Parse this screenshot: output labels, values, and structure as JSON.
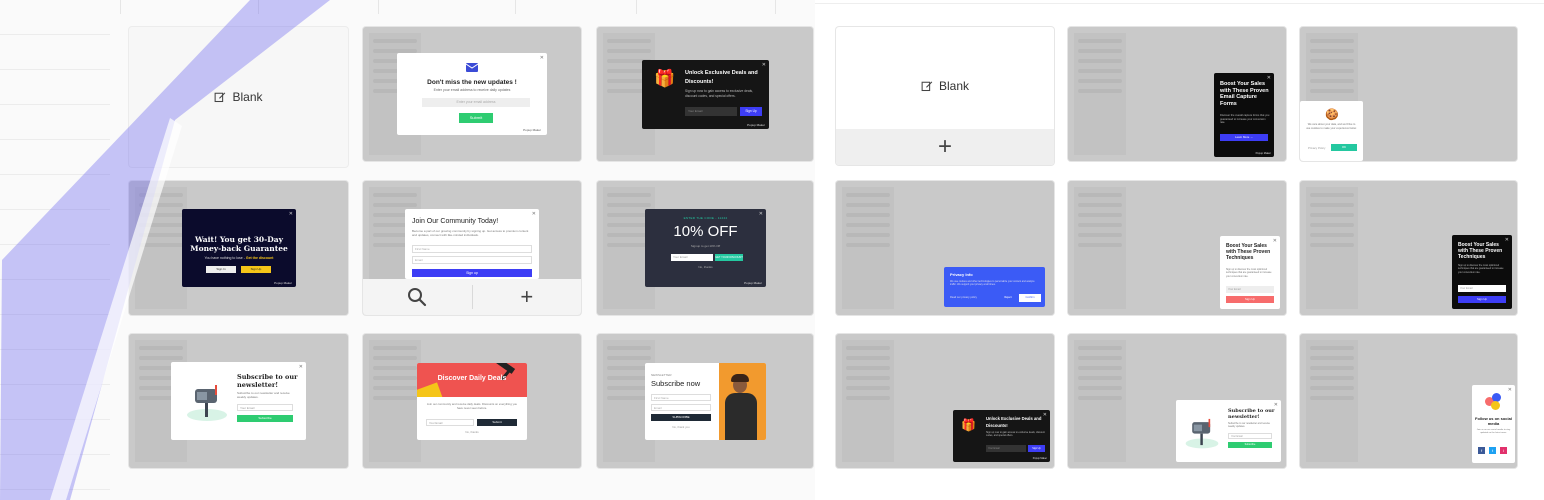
{
  "blank_label": "Blank",
  "add_symbol": "+",
  "search_symbol": "⚲",
  "templates": {
    "newsletter_envelope": {
      "title": "Don't miss the new updates !",
      "subtitle": "Enter your email address to receive daily updates",
      "placeholder": "Enter your email address",
      "button": "Submit",
      "brand": "Popup Maker"
    },
    "gift_deals": {
      "title": "Unlock Exclusive Deals and Discounts!",
      "body": "Sign up now to gain access to exclusive deals, discount codes, and special offers.",
      "placeholder": "Your Email",
      "button": "Sign Up",
      "brand": "Popup Maker"
    },
    "money_back": {
      "title": "Wait! You get 30-Day Money-back Guarantee",
      "body_a": "You have nothing to lose - ",
      "body_b": "Get the discount",
      "btn_a": "Sign In",
      "btn_b": "Sign Up",
      "brand": "Popup Maker"
    },
    "community": {
      "title": "Join Our Community Today!",
      "body": "Become a part of our growing community by signing up. Get access to premium content and updates, connect with like-minded individuals.",
      "field_a": "First Name",
      "field_b": "Email",
      "button": "Sign up"
    },
    "ten_off": {
      "kicker": "ENTER THE CODE - 11222",
      "title": "10% OFF",
      "sub": "Signup to get 10% Off",
      "placeholder": "Your Email",
      "button": "GET YOUR DISCOUNT",
      "note": "No, thanks",
      "brand": "Popup Maker"
    },
    "subscribe_mailbox": {
      "title": "Subscribe to our newsletter!",
      "body": "Subscribe to our newsletter and receive weekly updates.",
      "placeholder": "Your Email",
      "button": "Subscribe"
    },
    "daily_deals": {
      "title": "Discover Daily Deals",
      "body": "Join our community and receive daily deals. Discounts on everything you have never seen before.",
      "placeholder": "Your Email",
      "button": "Submit",
      "note": "No, thanks"
    },
    "subscribe_now": {
      "kicker": "NEWSLETTER",
      "title": "Subscribe now",
      "field_a": "First Name",
      "field_b": "Email",
      "button": "SUBSCRIBE",
      "note": "No, thank you"
    },
    "boost_dark": {
      "title": "Boost Your Sales with These Proven Email Capture Forms",
      "body": "Discover the overall capture forms that you guaranteed to increase your conversion rate.",
      "button": "Learn More  →",
      "brand": "Popup Maker"
    },
    "cookie": {
      "body": "We care about your data, and we'd like to use cookies to make your experience better.",
      "link": "Privacy Policy",
      "button": "OK"
    },
    "privacy_info": {
      "title": "Privacy Info",
      "body": "We use cookies and other technologies to personalize your content and analyze traffic. We support your privacy at all times.",
      "link": "Read our privacy policy",
      "btn_a": "Reject",
      "btn_b": "Confirm"
    },
    "boost_light": {
      "title": "Boost Your Sales with These Proven Techniques",
      "body": "Sign up to discover the most optimized techniques that are guaranteed to increase your conversion rate.",
      "placeholder": "Your Email",
      "button": "Sign Up"
    },
    "boost_black": {
      "title": "Boost Your Sales with These Proven Techniques",
      "body": "Sign up to discover the most optimized techniques that are guaranteed to increase your conversion rate.",
      "placeholder": "Your Email",
      "button": "Sign Up"
    },
    "gift_deals_small": {
      "title": "Unlock Exclusive Deals and Discounts!",
      "body": "Sign up now to gain access to exclusive deals, discount codes, and special offers.",
      "placeholder": "Your Email",
      "button": "Sign Up",
      "brand": "Popup Maker"
    },
    "subscribe_mailbox_small": {
      "title": "Subscribe to our newsletter!",
      "body": "Subscribe to our newsletter and receive weekly updates.",
      "placeholder": "Your Email",
      "button": "Subscribe"
    },
    "social": {
      "title": "Follow us on social media",
      "body": "Join us on our social media to stay updated on the latest news.",
      "icons": [
        "f",
        "t",
        "i"
      ]
    }
  },
  "colors": {
    "accent_purple": "#8b87f5",
    "green": "#2ecc71",
    "blue": "#3d3df5",
    "yellow": "#f5c518",
    "teal": "#24c8a0",
    "privacy_blue": "#3b5bf6"
  }
}
